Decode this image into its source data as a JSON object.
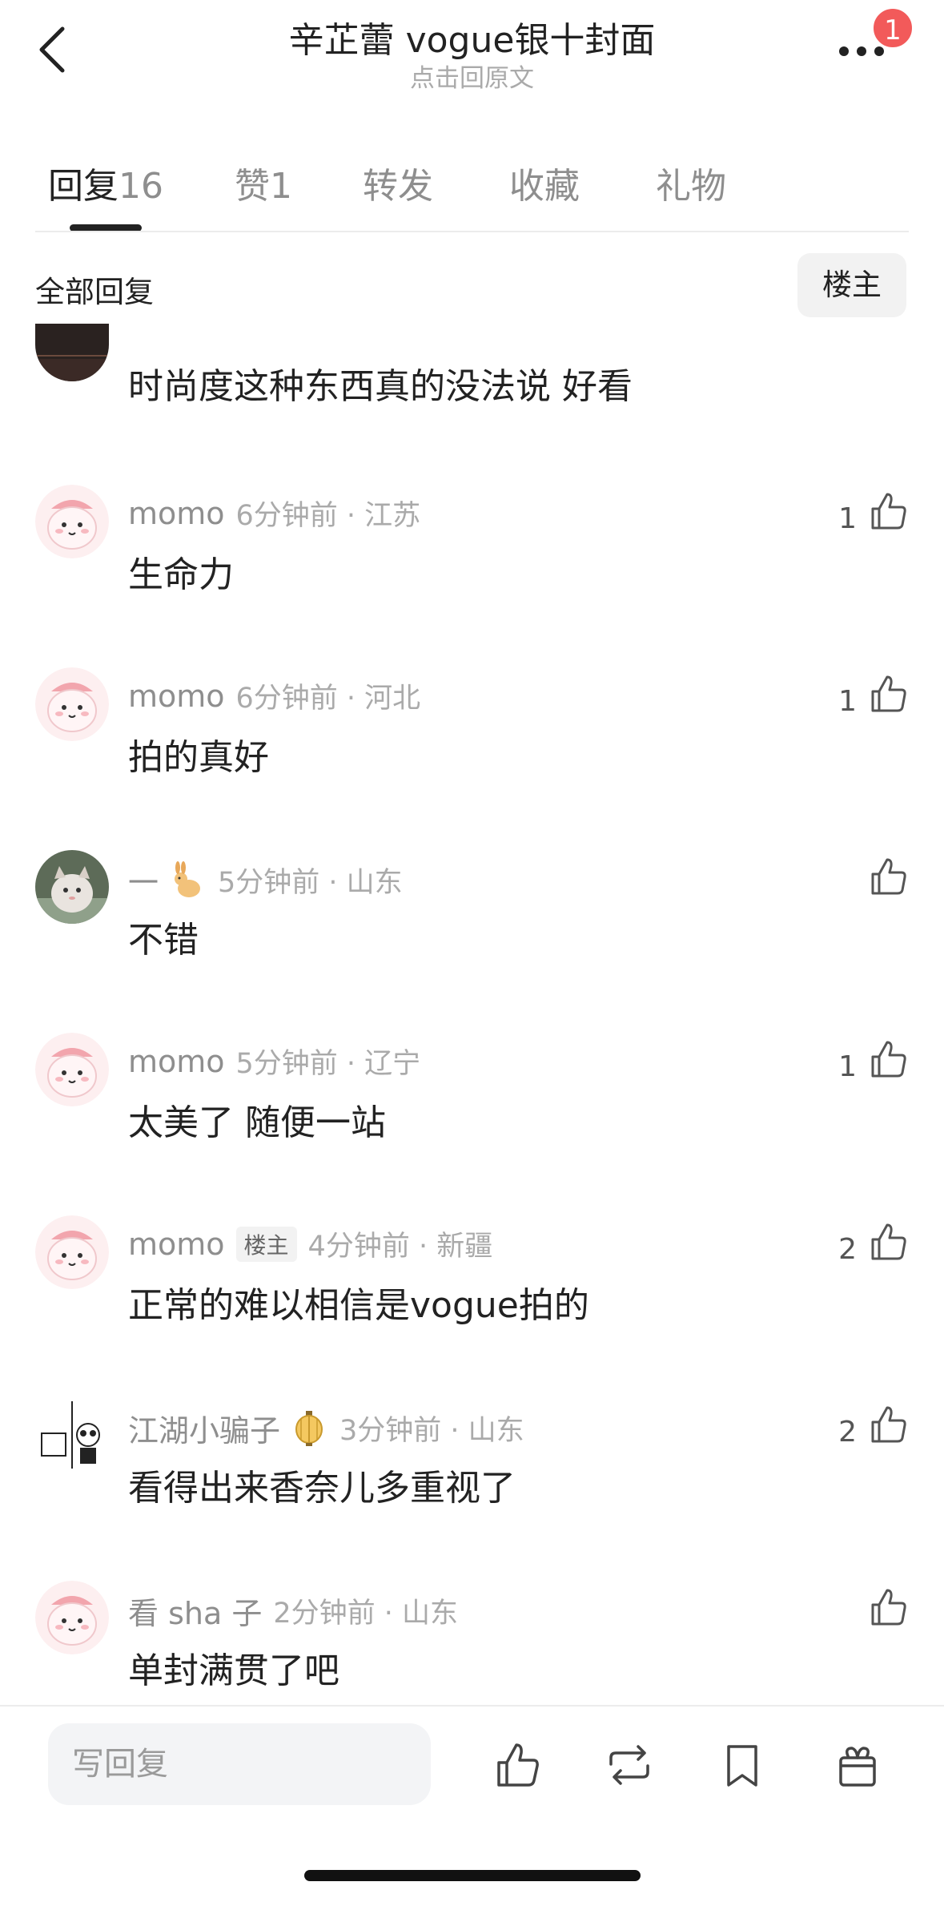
{
  "header": {
    "title": "辛芷蕾 vogue银十封面",
    "subtitle": "点击回原文",
    "notification_count": "1"
  },
  "tabs": [
    {
      "label": "回复",
      "count": "16",
      "active": true
    },
    {
      "label": "赞",
      "count": "1",
      "active": false
    },
    {
      "label": "转发",
      "count": "",
      "active": false
    },
    {
      "label": "收藏",
      "count": "",
      "active": false
    },
    {
      "label": "礼物",
      "count": "",
      "active": false
    }
  ],
  "filter": {
    "all_label": "全部回复",
    "op_label": "楼主"
  },
  "comments": [
    {
      "name": "",
      "time": "",
      "text": "时尚度这种东西真的没法说  好看",
      "likes": "",
      "partial": true
    },
    {
      "name": "momo",
      "time": "6分钟前 · 江苏",
      "text": "生命力",
      "likes": "1",
      "op": false
    },
    {
      "name": "momo",
      "time": "6分钟前 · 河北",
      "text": "拍的真好",
      "likes": "1",
      "op": false
    },
    {
      "name": "一",
      "badge_icon": "rabbit-icon",
      "time": "5分钟前 · 山东",
      "text": "不错",
      "likes": "",
      "op": false
    },
    {
      "name": "momo",
      "time": "5分钟前 · 辽宁",
      "text": "太美了 随便一站",
      "likes": "1",
      "op": false
    },
    {
      "name": "momo",
      "op_tag": "楼主",
      "time": "4分钟前 · 新疆",
      "text": "正常的难以相信是vogue拍的",
      "likes": "2",
      "op": true
    },
    {
      "name": "江湖小骗子",
      "badge_icon": "lantern-icon",
      "time": "3分钟前 · 山东",
      "text": "看得出来香奈儿多重视了",
      "likes": "2",
      "op": false
    },
    {
      "name": "看 sha 子",
      "time": "2分钟前 · 山东",
      "text": "单封满贯了吧",
      "likes": "",
      "op": false
    }
  ],
  "bottom_bar": {
    "reply_placeholder": "写回复",
    "icons": [
      "thumbs-up-icon",
      "repost-icon",
      "bookmark-icon",
      "gift-icon"
    ]
  },
  "colors": {
    "badge": "#f25a5a",
    "text_primary": "#222222",
    "text_secondary": "#8e8e8e"
  }
}
